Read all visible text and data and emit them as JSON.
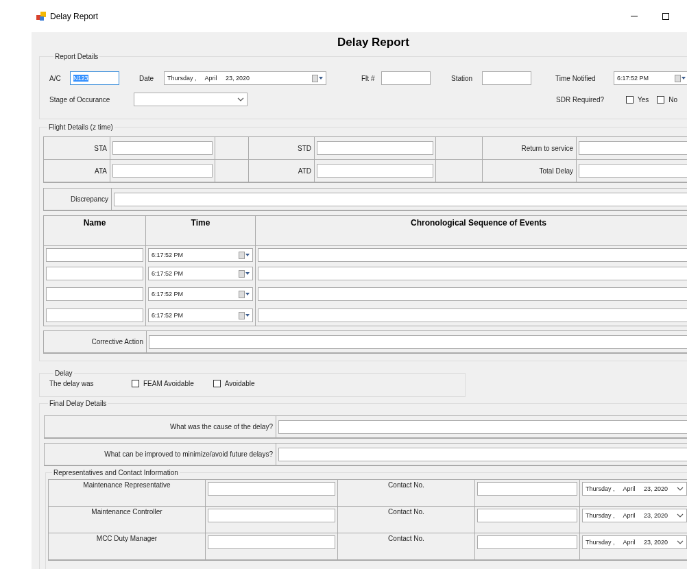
{
  "window": {
    "title": "Delay Report"
  },
  "heading": "Delay Report",
  "report_details": {
    "legend": "Report Details",
    "ac": {
      "label": "A/C",
      "value": "N123",
      "text_selected": true
    },
    "date": {
      "label": "Date",
      "value": "Thursday ,     April     23, 2020"
    },
    "flt": {
      "label": "Flt #"
    },
    "station": {
      "label": "Station"
    },
    "time_notified": {
      "label": "Time Notified",
      "value": "6:17:52 PM"
    },
    "stage": {
      "label": "Stage of Occurance"
    },
    "sdr": {
      "label": "SDR Required?",
      "options": [
        {
          "label": "Yes",
          "checked": false
        },
        {
          "label": "No",
          "checked": false
        }
      ]
    }
  },
  "flight_details": {
    "legend": "Flight Details (z time)",
    "rows": [
      [
        "STA",
        "STD",
        "Return to service"
      ],
      [
        "ATA",
        "ATD",
        "Total Delay"
      ]
    ],
    "discrepancy": "Discrepancy",
    "events": {
      "columns": [
        "Name",
        "Time",
        "Chronological Sequence of Events"
      ],
      "rows": [
        {
          "time": "6:17:52 PM"
        },
        {
          "time": "6:17:52 PM"
        },
        {
          "time": "6:17:52 PM"
        },
        {
          "time": "6:17:52 PM"
        }
      ]
    },
    "corrective_action": "Corrective Action"
  },
  "delay": {
    "legend": "Delay",
    "label": "The delay was",
    "options": [
      {
        "label": "FEAM Avoidable",
        "checked": false
      },
      {
        "label": "Avoidable",
        "checked": false
      }
    ]
  },
  "final_delay_details": {
    "legend": "Final Delay Details",
    "questions": [
      "What was the cause of the delay?",
      "What can be improved to minimize/avoid future delays?"
    ],
    "representatives": {
      "legend": "Representatives and Contact Information",
      "rows": [
        {
          "role": "Maintenance Representative",
          "contact_label": "Contact No.",
          "date": "Thursday ,     April     23, 2020"
        },
        {
          "role": "Maintenance Controller",
          "contact_label": "Contact No.",
          "date": "Thursday ,     April     23, 2020"
        },
        {
          "role": "MCC Duty Manager",
          "contact_label": "Contact No.",
          "date": "Thursday ,     April     23, 2020"
        }
      ]
    }
  }
}
